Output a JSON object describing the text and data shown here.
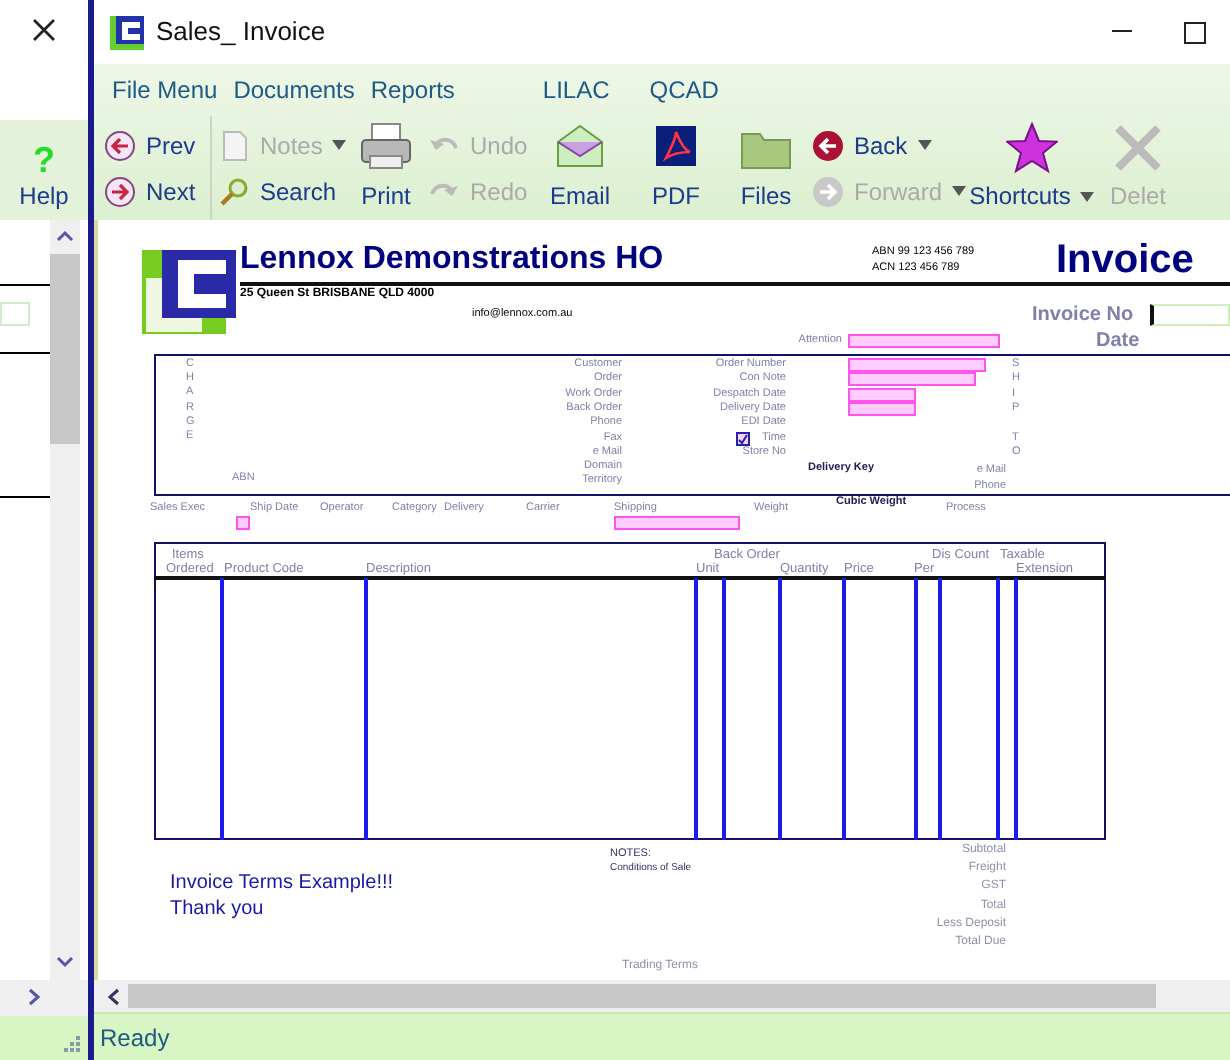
{
  "side_pane": {
    "help_icon": "?",
    "help_label": "Help"
  },
  "window": {
    "title": "Sales_ Invoice"
  },
  "menu": [
    "File Menu",
    "Documents",
    "Reports",
    "LILAC",
    "QCAD"
  ],
  "toolbar": [
    {
      "label": "Prev",
      "kind": "small",
      "disabled": false,
      "dropdown": false
    },
    {
      "label": "Next",
      "kind": "small",
      "disabled": false,
      "dropdown": false
    },
    {
      "label": "Notes",
      "kind": "small",
      "disabled": true,
      "dropdown": true
    },
    {
      "label": "Search",
      "kind": "small",
      "disabled": false,
      "dropdown": false
    },
    {
      "label": "Print",
      "kind": "large",
      "disabled": false,
      "dropdown": false
    },
    {
      "label": "Undo",
      "kind": "small",
      "disabled": true,
      "dropdown": false
    },
    {
      "label": "Redo",
      "kind": "small",
      "disabled": true,
      "dropdown": false
    },
    {
      "label": "Email",
      "kind": "large",
      "disabled": false,
      "dropdown": false
    },
    {
      "label": "PDF",
      "kind": "large",
      "disabled": false,
      "dropdown": false
    },
    {
      "label": "Files",
      "kind": "large",
      "disabled": false,
      "dropdown": false
    },
    {
      "label": "Back",
      "kind": "small",
      "disabled": false,
      "dropdown": true
    },
    {
      "label": "Forward",
      "kind": "small",
      "disabled": true,
      "dropdown": true
    },
    {
      "label": "Shortcuts",
      "kind": "large",
      "disabled": false,
      "dropdown": true
    },
    {
      "label": "Delet",
      "kind": "large",
      "disabled": true,
      "dropdown": false
    }
  ],
  "report": {
    "company": "Lennox Demonstrations HO",
    "address": "25 Queen St BRISBANE QLD 4000",
    "email": "info@lennox.com.au",
    "abn": "ABN 99 123 456 789",
    "acn": "ACN 123 456 789",
    "title": "Invoice",
    "invoice_no_label": "Invoice No",
    "date_label": "Date",
    "attention_label": "Attention",
    "charge_letters": [
      "C",
      "H",
      "A",
      "R",
      "G",
      "E"
    ],
    "customer_labels": [
      "Customer",
      "Order",
      "Work Order",
      "Back Order",
      "Phone",
      "Fax",
      "e Mail",
      "Domain",
      "Territory"
    ],
    "abn_label": "ABN",
    "order_fields": [
      {
        "label": "Order Number",
        "kind": "long"
      },
      {
        "label": "Con Note",
        "kind": "medium"
      },
      {
        "label": "Despatch Date",
        "kind": "short"
      },
      {
        "label": "Delivery Date",
        "kind": "short"
      },
      {
        "label": "EDI Date",
        "kind": "none"
      },
      {
        "label": "Time",
        "kind": "none"
      },
      {
        "label": "Store No",
        "kind": "none"
      }
    ],
    "fax_checkbox": {
      "checked": true
    },
    "ship_letters": [
      "S",
      "H",
      "I",
      "P"
    ],
    "to_letters": [
      "T",
      "O"
    ],
    "delivery_key": "Delivery Key",
    "ship_email_label": "e Mail",
    "ship_phone_label": "Phone",
    "info_labels": [
      "Sales Exec",
      "Ship Date",
      "Operator",
      "Category",
      "Delivery",
      "Carrier",
      "Shipping",
      "Weight",
      "Cubic Weight",
      "Process"
    ],
    "column_headers": [
      "Items",
      "Back Order",
      "Dis Count",
      "Taxable",
      "Ordered",
      "Product Code",
      "Description",
      "Unit",
      "Quantity",
      "Price",
      "Per",
      "Extension"
    ],
    "notes_label": "NOTES:",
    "conditions_label": "Conditions of Sale",
    "terms": [
      "Invoice Terms Example!!!",
      "Thank you"
    ],
    "totals": [
      "Subtotal",
      "Freight",
      "GST",
      "Total",
      "Less Deposit",
      "Total Due"
    ],
    "trading_terms": "Trading Terms"
  },
  "status_bar": {
    "text": "Ready"
  }
}
